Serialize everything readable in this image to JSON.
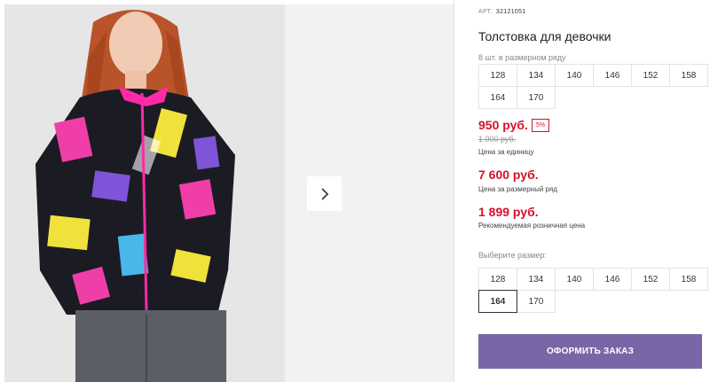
{
  "product": {
    "sku_label": "АРТ.",
    "sku": "32121051",
    "title": "Толстовка для девочки",
    "series_note": "8 шт. в размерном ряду"
  },
  "size_range": [
    "128",
    "134",
    "140",
    "146",
    "152",
    "158",
    "164",
    "170"
  ],
  "pricing": {
    "unit_price": "950 руб.",
    "discount_badge": "5%",
    "old_price": "1 000 руб.",
    "unit_label": "Цена за единицу",
    "series_price": "7 600 руб.",
    "series_label": "Цена за размерный ряд",
    "retail_price": "1 899 руб.",
    "retail_label": "Рекомендуемая розничная цена"
  },
  "size_selector": {
    "label": "Выберите размер:",
    "options": [
      "128",
      "134",
      "140",
      "146",
      "152",
      "158",
      "164",
      "170"
    ],
    "selected": "164"
  },
  "order_button": "ОФОРМИТЬ ЗАКАЗ",
  "colors": {
    "price_red": "#d6112a",
    "button_purple": "#7a66a6"
  },
  "icons": {
    "gallery_next": "chevron-right-icon"
  }
}
